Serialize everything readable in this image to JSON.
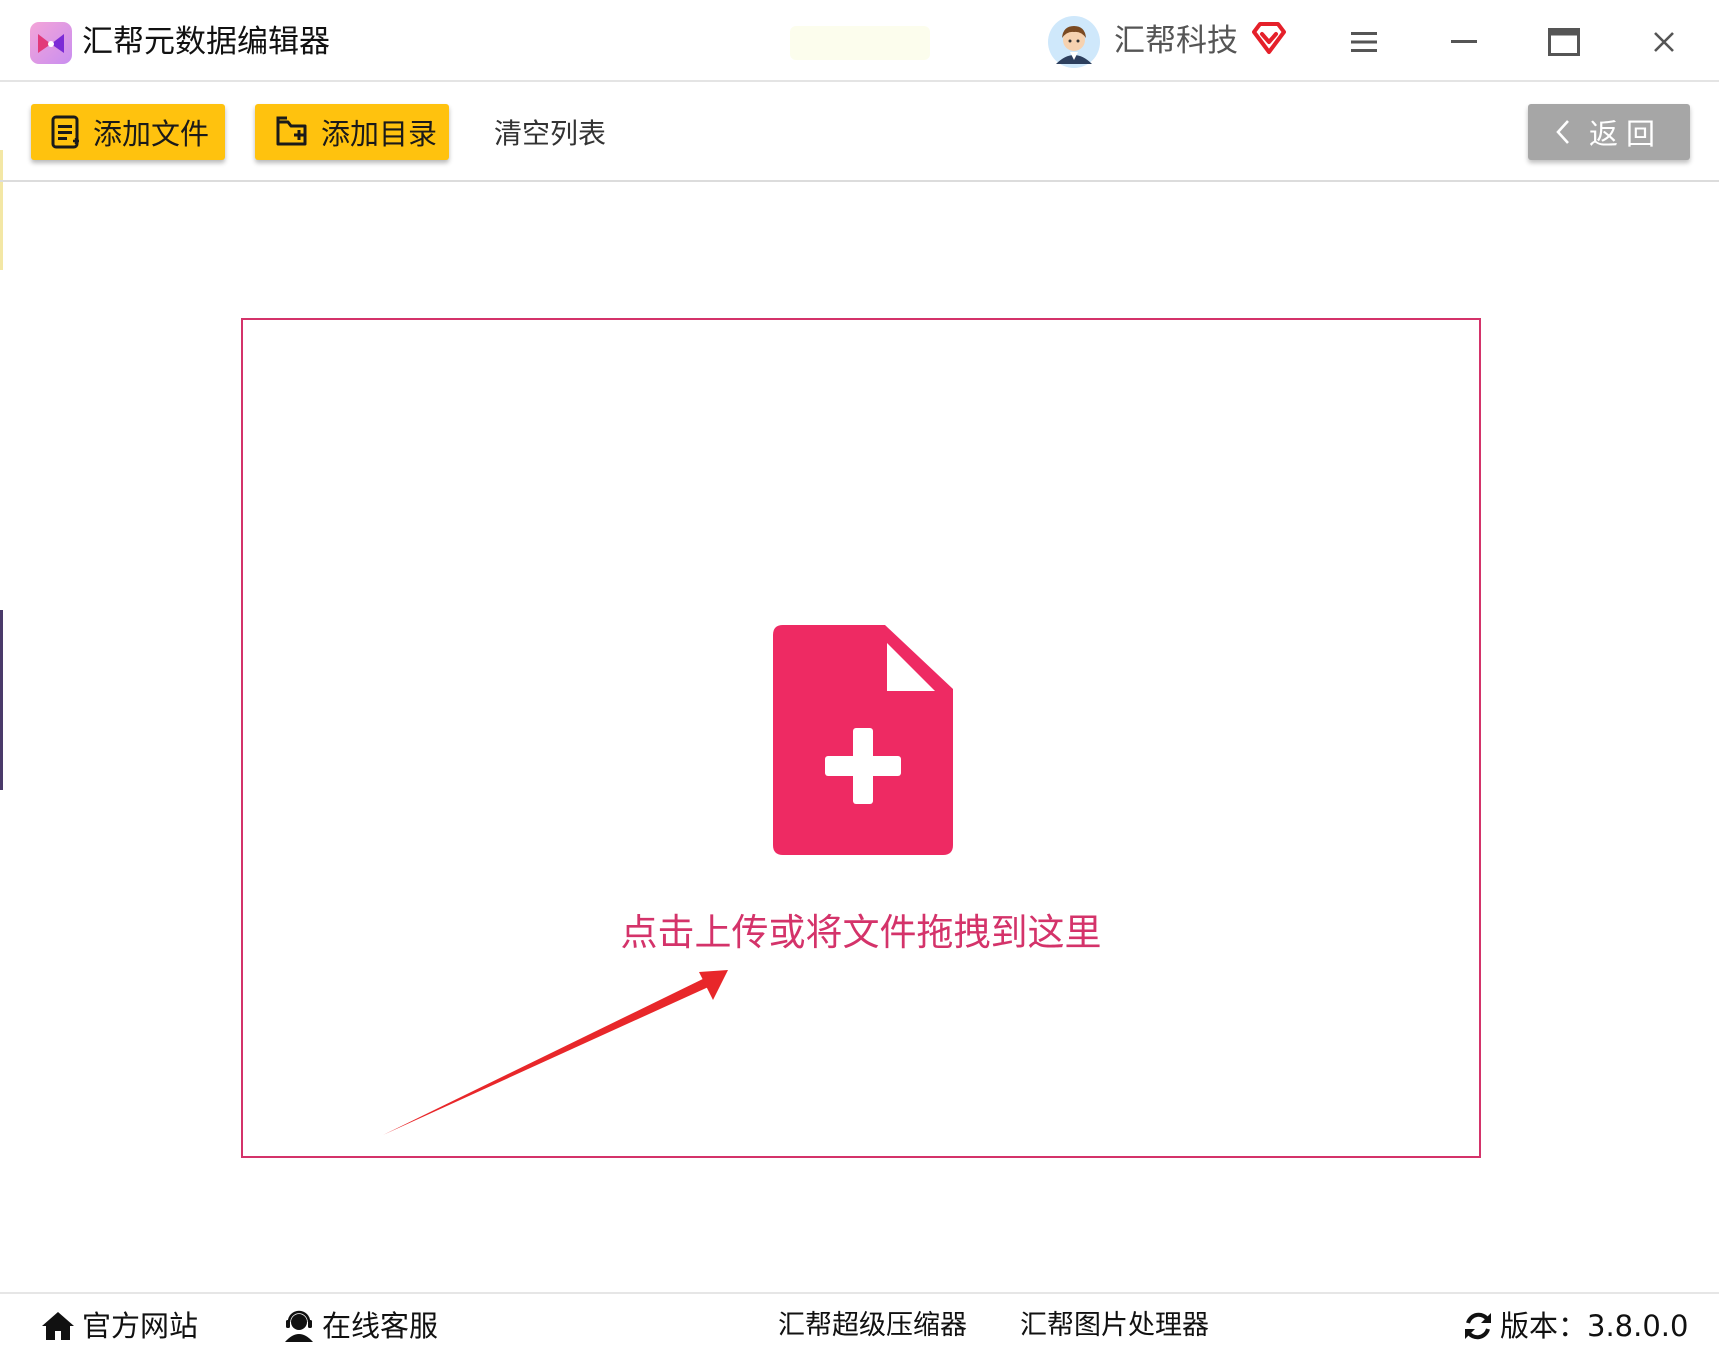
{
  "app": {
    "title": "汇帮元数据编辑器",
    "logo_icon": "app-logo-icon"
  },
  "header": {
    "user_name": "汇帮科技",
    "avatar_icon": "avatar-icon",
    "vip_icon": "vip-diamond-icon",
    "vip_color": "#e5202a",
    "window_controls": [
      "menu-icon",
      "minimize-icon",
      "maximize-icon",
      "close-icon"
    ]
  },
  "toolbar": {
    "add_file_label": "添加文件",
    "add_dir_label": "添加目录",
    "clear_label": "清空列表",
    "back_label": "返回",
    "accent_color": "#ffc20e",
    "back_color": "#a6a6a6"
  },
  "dropzone": {
    "hint": "点击上传或将文件拖拽到这里",
    "icon": "file-add-icon",
    "accent_color": "#ee2a63",
    "border_color": "#d4336a",
    "arrow_color": "#e8272a"
  },
  "footer": {
    "site_label": "官方网站",
    "service_label": "在线客服",
    "compressor_label": "汇帮超级压缩器",
    "image_tool_label": "汇帮图片处理器",
    "version_label": "版本：3.8.0.0"
  }
}
